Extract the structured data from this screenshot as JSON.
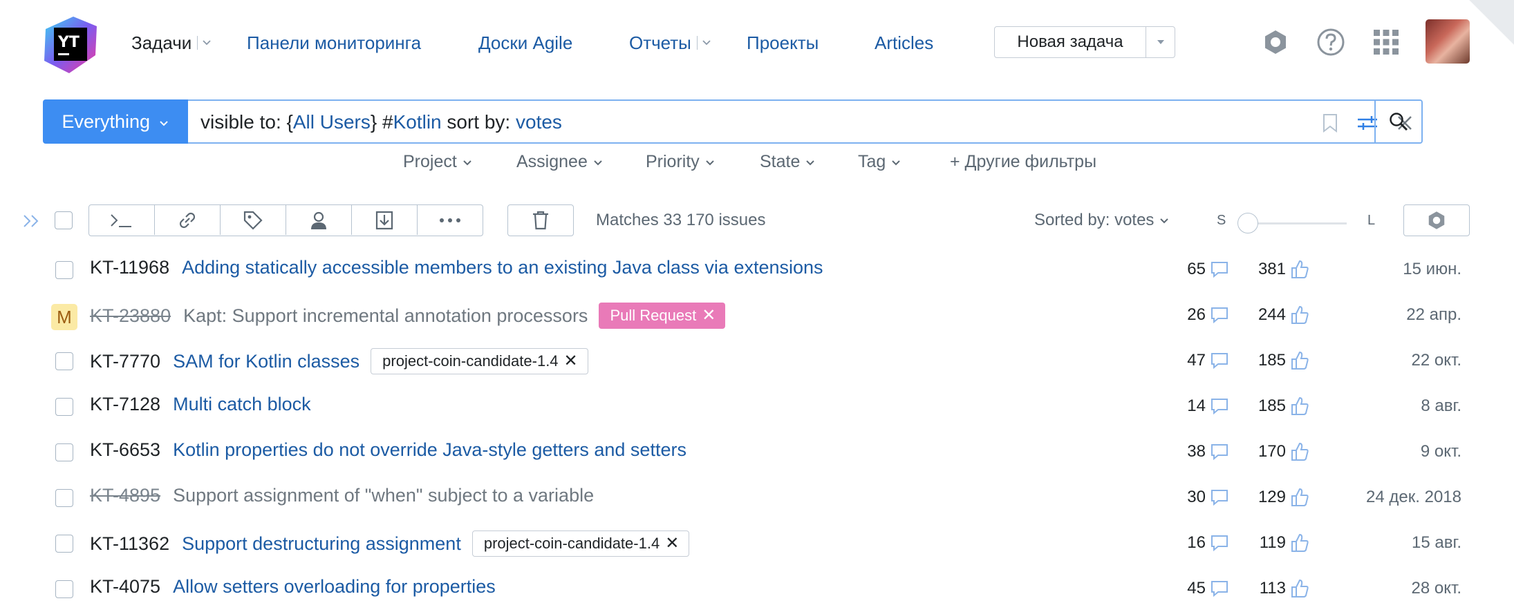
{
  "app": {
    "logo_text": "YT"
  },
  "nav": {
    "items": [
      {
        "label": "Задачи",
        "has_caret": true
      },
      {
        "label": "Панели мониторинга"
      },
      {
        "label": "Доски Agile"
      },
      {
        "label": "Отчеты",
        "has_caret": true
      },
      {
        "label": "Проекты"
      },
      {
        "label": "Articles"
      }
    ],
    "new_issue_label": "Новая задача",
    "icons": [
      "settings-icon",
      "help-icon",
      "apps-grid-icon"
    ],
    "avatar": "user-avatar"
  },
  "search": {
    "context_label": "Everything",
    "query": {
      "p1": "visible to: {",
      "p2": "All Users",
      "p3": "} #",
      "p4": "Kotlin",
      "p5": " sort by: ",
      "p6": "votes"
    }
  },
  "filters": {
    "project": "Project",
    "assignee": "Assignee",
    "priority": "Priority",
    "state": "State",
    "tag": "Tag",
    "more": "+ Другие фильтры"
  },
  "toolbar": {
    "matches": "Matches 33 170 issues",
    "sorted_by": "Sorted by: votes",
    "size_small": "S",
    "size_large": "L",
    "density_level": 0
  },
  "issues": [
    {
      "id": "KT-11968",
      "summary": "Adding statically accessible members to an existing Java class via extensions",
      "resolved": false,
      "tag": "",
      "comments": "65",
      "votes": "381",
      "date": "15 июн."
    },
    {
      "id": "KT-23880",
      "summary": "Kapt: Support incremental annotation processors",
      "resolved": true,
      "badge": "M",
      "tag": "Pull Request",
      "comments": "26",
      "votes": "244",
      "date": "22 апр."
    },
    {
      "id": "KT-7770",
      "summary": "SAM for Kotlin classes",
      "resolved": false,
      "tag": "project-coin-candidate-1.4",
      "comments": "47",
      "votes": "185",
      "date": "22 окт."
    },
    {
      "id": "KT-7128",
      "summary": "Multi catch block",
      "resolved": false,
      "tag": "",
      "comments": "14",
      "votes": "185",
      "date": "8 авг."
    },
    {
      "id": "KT-6653",
      "summary": "Kotlin properties do not override Java-style getters and setters",
      "resolved": false,
      "tag": "",
      "comments": "38",
      "votes": "170",
      "date": "9 окт."
    },
    {
      "id": "KT-4895",
      "summary": "Support assignment of \"when\" subject to a variable",
      "resolved": true,
      "tag": "",
      "comments": "30",
      "votes": "129",
      "date": "24 дек. 2018"
    },
    {
      "id": "KT-11362",
      "summary": "Support destructuring assignment",
      "resolved": false,
      "tag": "project-coin-candidate-1.4",
      "comments": "16",
      "votes": "119",
      "date": "15 авг."
    },
    {
      "id": "KT-4075",
      "summary": "Allow setters overloading for properties",
      "resolved": false,
      "tag": "",
      "comments": "45",
      "votes": "113",
      "date": "28 окт."
    }
  ],
  "colors": {
    "accent": "#3d8df2",
    "link": "#1c5ba4",
    "pull_request_tag": "#e97ab8",
    "badge_m": "#fbeaa5"
  }
}
